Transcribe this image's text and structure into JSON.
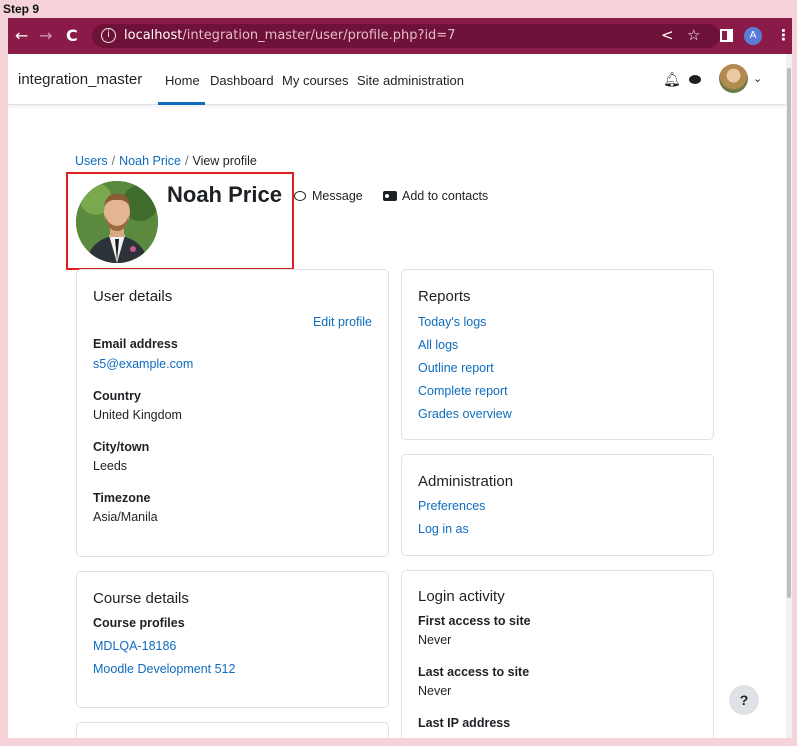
{
  "step_label": "Step 9",
  "browser": {
    "url_host": "localhost",
    "url_path": "/integration_master/user/profile.php?id=7",
    "profile_initial": "A"
  },
  "navbar": {
    "brand": "integration_master",
    "links": [
      "Home",
      "Dashboard",
      "My courses",
      "Site administration"
    ],
    "active": "Home"
  },
  "breadcrumb": {
    "items": [
      "Users",
      "Noah Price",
      "View profile"
    ],
    "separator": "/"
  },
  "profile": {
    "name": "Noah Price",
    "message_label": "Message",
    "add_contacts_label": "Add to contacts"
  },
  "user_details": {
    "title": "User details",
    "edit_label": "Edit profile",
    "email_label": "Email address",
    "email_value": "s5@example.com",
    "country_label": "Country",
    "country_value": "United Kingdom",
    "city_label": "City/town",
    "city_value": "Leeds",
    "timezone_label": "Timezone",
    "timezone_value": "Asia/Manila"
  },
  "reports": {
    "title": "Reports",
    "links": [
      "Today's logs",
      "All logs",
      "Outline report",
      "Complete report",
      "Grades overview"
    ]
  },
  "administration": {
    "title": "Administration",
    "links": [
      "Preferences",
      "Log in as"
    ]
  },
  "course_details": {
    "title": "Course details",
    "profiles_label": "Course profiles",
    "courses": [
      "MDLQA-18186",
      "Moodle Development 512"
    ]
  },
  "login_activity": {
    "title": "Login activity",
    "first_access_label": "First access to site",
    "first_access_value": "Never",
    "last_access_label": "Last access to site",
    "last_access_value": "Never",
    "last_ip_label": "Last IP address"
  },
  "help_label": "?",
  "colors": {
    "browser_chrome": "#8a1b48",
    "link": "#0f6cbf",
    "highlight": "#e02020",
    "background": "#f6d3d8"
  }
}
